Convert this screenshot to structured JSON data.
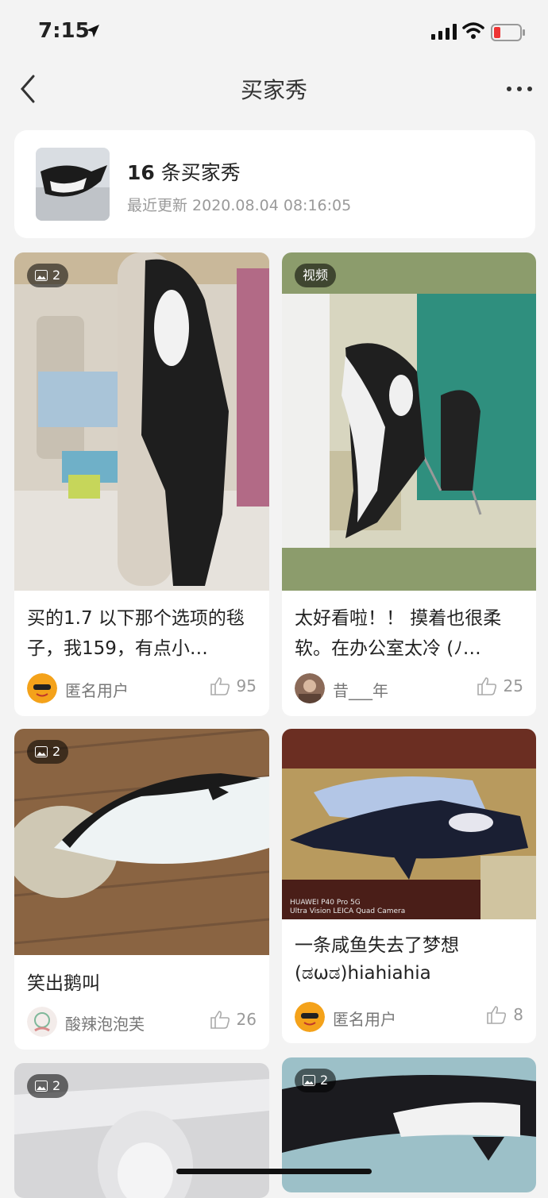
{
  "status_bar": {
    "time": "7:15"
  },
  "nav": {
    "title": "买家秀"
  },
  "summary": {
    "count": "16",
    "count_suffix": "条买家秀",
    "updated": "最近更新 2020.08.04 08:16:05"
  },
  "cards": [
    {
      "badge": "2",
      "text": "买的1.7 以下那个选项的毯子，我159，有点小…",
      "author": "匿名用户",
      "likes": "95"
    },
    {
      "badge": "视频",
      "text": "太好看啦！！ 摸着也很柔软。在办公室太冷 (ﾉ…",
      "author": "昔___年",
      "likes": "25"
    },
    {
      "badge": "2",
      "text": "笑出鹅叫",
      "author": "酸辣泡泡芙",
      "likes": "26"
    },
    {
      "text": "一条咸鱼失去了梦想 (ಡωಡ)hiahiahia",
      "author": "匿名用户",
      "likes": "8",
      "watermark_line1": "HUAWEI P40 Pro 5G",
      "watermark_line2": "Ultra Vision LEICA Quad Camera"
    },
    {
      "badge": "2"
    },
    {
      "badge": "2"
    }
  ]
}
